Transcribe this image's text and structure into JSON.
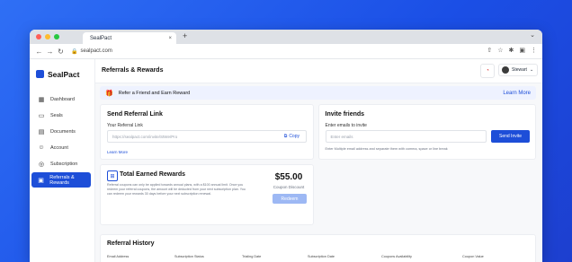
{
  "browser": {
    "tab_title": "SealPact",
    "tab_close": "×",
    "new_tab": "+",
    "url": "sealpact.com",
    "dots": [
      "#ff5f57",
      "#febc2e",
      "#28c840"
    ]
  },
  "app": {
    "logo_text": "SealPact",
    "page_title": "Referrals & Rewards",
    "user_name": "Stewart",
    "accent_color": "#1d4ed8"
  },
  "sidebar": {
    "items": [
      {
        "label": "Dashboard",
        "icon": "grid-icon"
      },
      {
        "label": "Seals",
        "icon": "seal-icon"
      },
      {
        "label": "Documents",
        "icon": "document-icon"
      },
      {
        "label": "Account",
        "icon": "user-icon"
      },
      {
        "label": "Subscription",
        "icon": "subscription-icon"
      },
      {
        "label": "Referrals & Rewards",
        "icon": "referral-icon",
        "active": true
      }
    ]
  },
  "banner": {
    "text": "Refer a Friend and Earn Reward",
    "link": "Learn More"
  },
  "send_referral": {
    "title": "Send Referral Link",
    "label": "Your Referral Link",
    "link_value": "https://sealpact.com/invite/StWe/Pro",
    "copy_label": "Copy",
    "learn_more": "Learn More"
  },
  "invite": {
    "title": "Invite friends",
    "label": "Enter emails to invite",
    "placeholder": "Enter emails",
    "button": "Send Invite",
    "hint": "Enter Multiple email address and separate them with comma, space or line break"
  },
  "rewards": {
    "title": "Total Earned Rewards",
    "description": "Referral coupons can only be applied towards annual plans, with a $100 annual limit. Once you redeem your referral coupons, the amount will be deducted from your next subscription plan. You can redeem your rewards 30 days before your next subscription renewal.",
    "amount": "$55.00",
    "amount_label": "Coupon Discount",
    "redeem": "Redeem"
  },
  "history": {
    "title": "Referral History",
    "columns": [
      "Email Address",
      "Subscription Status",
      "Trialing Date",
      "Subscription Date",
      "Coupons Availability",
      "Coupon Value"
    ]
  }
}
